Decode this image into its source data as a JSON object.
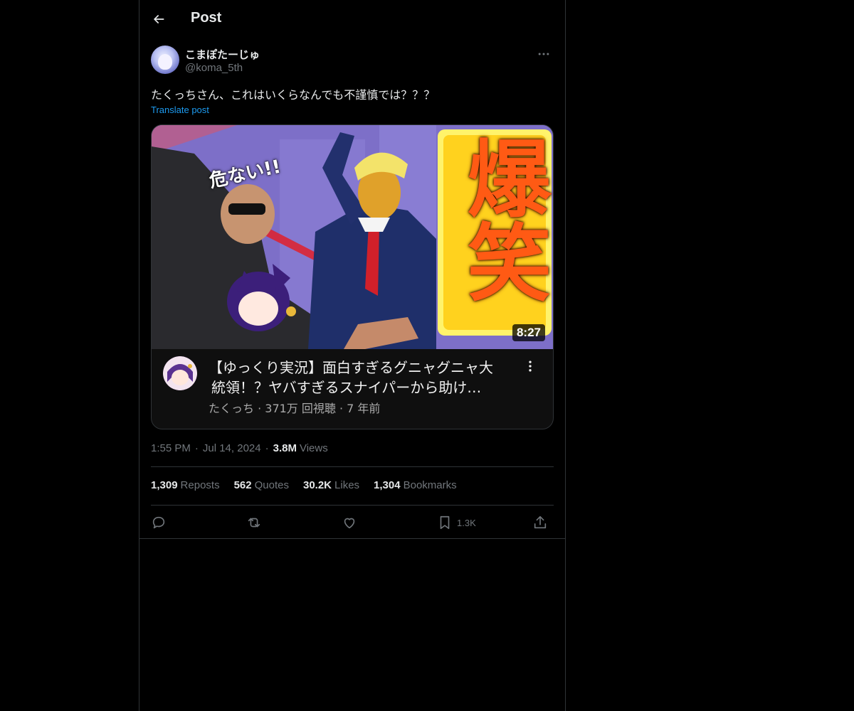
{
  "header": {
    "title": "Post",
    "back_icon": "arrow-left-icon"
  },
  "post": {
    "author": {
      "display_name": "こまぽたーじゅ",
      "handle": "@koma_5th",
      "avatar_icon": "user-avatar"
    },
    "text": "たくっちさん、これはいくらなんでも不謹慎では？？？",
    "translate_label": "Translate post",
    "timestamp": "1:55 PM",
    "separator": "·",
    "date": "Jul 14, 2024",
    "views_count": "3.8M",
    "views_label": "Views"
  },
  "video_card": {
    "duration": "8:27",
    "title": "【ゆっくり実況】面白すぎるグニャグニャ大統領！？ヤバすぎるスナイパーから助け…",
    "title_line1": "【ゆっくり実況】面白すぎるグニャグニャ大",
    "title_line2": "統領！？ヤバすぎるスナイパーから助け…",
    "meta": "たくっち · 371万 回視聴 · 7 年前",
    "thumbnail_caption": "危ない!!",
    "thumbnail_big_text": "爆笑"
  },
  "stats": [
    {
      "value": "1,309",
      "label": "Reposts"
    },
    {
      "value": "562",
      "label": "Quotes"
    },
    {
      "value": "30.2K",
      "label": "Likes"
    },
    {
      "value": "1,304",
      "label": "Bookmarks"
    }
  ],
  "actions": {
    "reply_icon": "reply-icon",
    "repost_icon": "repost-icon",
    "like_icon": "heart-icon",
    "bookmark_icon": "bookmark-icon",
    "bookmark_count": "1.3K",
    "share_icon": "share-icon"
  },
  "colors": {
    "background": "#000000",
    "text_primary": "#e7e9ea",
    "text_secondary": "#71767b",
    "accent": "#1d9bf0",
    "border": "#2f3336"
  }
}
